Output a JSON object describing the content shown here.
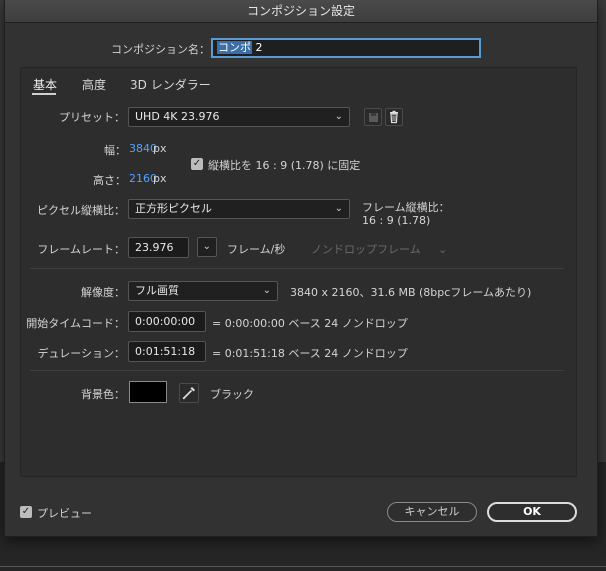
{
  "dialog": {
    "title": "コンポジション設定"
  },
  "name_field": {
    "label": "コンポジション名：",
    "value_selected": "コンポ",
    "value_rest": " 2"
  },
  "tabs": [
    {
      "label": "基本"
    },
    {
      "label": "高度"
    },
    {
      "label": "3D レンダラー"
    }
  ],
  "preset": {
    "label": "プリセット：",
    "value": "UHD 4K 23.976"
  },
  "width": {
    "label": "幅：",
    "value": "3840",
    "unit": "px"
  },
  "height": {
    "label": "高さ：",
    "value": "2160",
    "unit": "px"
  },
  "aspect_lock": {
    "label": "縦横比を 16 : 9 (1.78) に固定",
    "checked": true
  },
  "pixel_aspect": {
    "label": "ピクセル縦横比：",
    "value": "正方形ピクセル"
  },
  "frame_aspect": {
    "label": "フレーム縦横比：",
    "value": "16 : 9 (1.78)"
  },
  "frame_rate": {
    "label": "フレームレート：",
    "value": "23.976",
    "unit": "フレーム/秒",
    "dropframe": "ノンドロップフレーム"
  },
  "resolution": {
    "label": "解像度：",
    "value": "フル画質",
    "info": "3840 x 2160、31.6 MB (8bpcフレームあたり)"
  },
  "start_timecode": {
    "label": "開始タイムコード：",
    "value": "0:00:00:00",
    "equals": "= 0:00:00:00 ベース 24 ノンドロップ"
  },
  "duration": {
    "label": "デュレーション：",
    "value": "0:01:51:18",
    "equals": "= 0:01:51:18 ベース 24 ノンドロップ"
  },
  "background": {
    "label": "背景色：",
    "color": "#000000",
    "color_name": "ブラック"
  },
  "preview": {
    "label": "プレビュー",
    "checked": true
  },
  "buttons": {
    "cancel": "キャンセル",
    "ok": "OK"
  },
  "colors": {
    "accent_blue": "#4ea3ff",
    "focus_ring": "#5b9bd5"
  }
}
